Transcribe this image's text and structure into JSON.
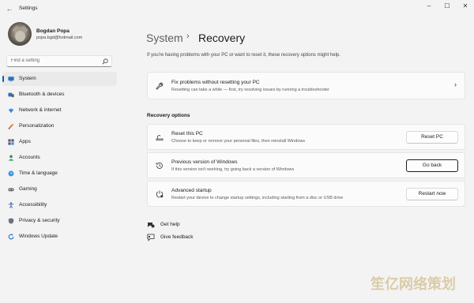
{
  "window": {
    "title": "Settings",
    "controls": {
      "minimize": "–",
      "maximize": "☐",
      "close": "✕"
    }
  },
  "profile": {
    "name": "Bogdan Popa",
    "email": "popa.bgd@hotmail.com"
  },
  "search": {
    "placeholder": "Find a setting"
  },
  "sidebar": {
    "items": [
      {
        "label": "System",
        "icon": "system-icon",
        "active": true
      },
      {
        "label": "Bluetooth & devices",
        "icon": "bluetooth-icon"
      },
      {
        "label": "Network & internet",
        "icon": "network-icon"
      },
      {
        "label": "Personalization",
        "icon": "personalization-icon"
      },
      {
        "label": "Apps",
        "icon": "apps-icon"
      },
      {
        "label": "Accounts",
        "icon": "accounts-icon"
      },
      {
        "label": "Time & language",
        "icon": "time-language-icon"
      },
      {
        "label": "Gaming",
        "icon": "gaming-icon"
      },
      {
        "label": "Accessibility",
        "icon": "accessibility-icon"
      },
      {
        "label": "Privacy & security",
        "icon": "privacy-icon"
      },
      {
        "label": "Windows Update",
        "icon": "windows-update-icon"
      }
    ]
  },
  "header": {
    "parent": "System",
    "separator": "›",
    "current": "Recovery"
  },
  "intro": "If you're having problems with your PC or want to reset it, these recovery options might help.",
  "fix_card": {
    "title": "Fix problems without resetting your PC",
    "description": "Resetting can take a while — first, try resolving issues by running a troubleshooter",
    "chevron": "›"
  },
  "recovery": {
    "section_title": "Recovery options",
    "options": [
      {
        "title": "Reset this PC",
        "description": "Choose to keep or remove your personal files, then reinstall Windows",
        "button": "Reset PC"
      },
      {
        "title": "Previous version of Windows",
        "description": "If this version isn't working, try going back a version of Windows",
        "button": "Go back"
      },
      {
        "title": "Advanced startup",
        "description": "Restart your device to change startup settings, including starting from a disc or USB drive",
        "button": "Restart now"
      }
    ]
  },
  "links": {
    "help": "Get help",
    "feedback": "Give feedback"
  },
  "watermark": "笙亿网络策划",
  "colors": {
    "accent": "#005fb8",
    "background": "#f3f3f3",
    "card": "#fbfbfb"
  }
}
